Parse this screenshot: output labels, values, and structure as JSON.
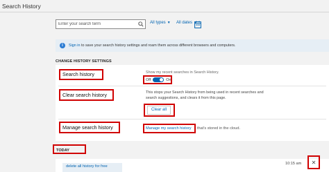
{
  "header": {
    "title": "Search History"
  },
  "search": {
    "placeholder": "Enter your search term"
  },
  "filters": {
    "types": "All types",
    "dates": "All dates"
  },
  "banner": {
    "link": "Sign in",
    "text": "to save your search history settings and roam them across different browsers and computers."
  },
  "settings": {
    "heading": "CHANGE HISTORY SETTINGS",
    "search_history": {
      "label": "Search history",
      "description": "Show my recent searches in Search History.",
      "toggle_off": "Off",
      "toggle_on": "On",
      "toggle_state": "on"
    },
    "clear_history": {
      "label": "Clear search history",
      "description_line1": "This stops your Search History from being used in recent searches and",
      "description_line2": "search suggestions, and clears it from this page.",
      "button": "Clear all"
    },
    "manage_history": {
      "label": "Manage search history",
      "link": "Manage my search history",
      "rest": "that's stored in the cloud."
    }
  },
  "today": {
    "heading": "TODAY",
    "items": [
      {
        "query": "delete all history for free",
        "time": "10:15 am"
      }
    ]
  },
  "colors": {
    "accent": "#0063b1",
    "annotation": "#d00000",
    "banner": "#e6eef5"
  },
  "icons": {
    "search": "search-icon",
    "calendar": "calendar-icon",
    "info": "info-icon",
    "close": "close-icon"
  }
}
